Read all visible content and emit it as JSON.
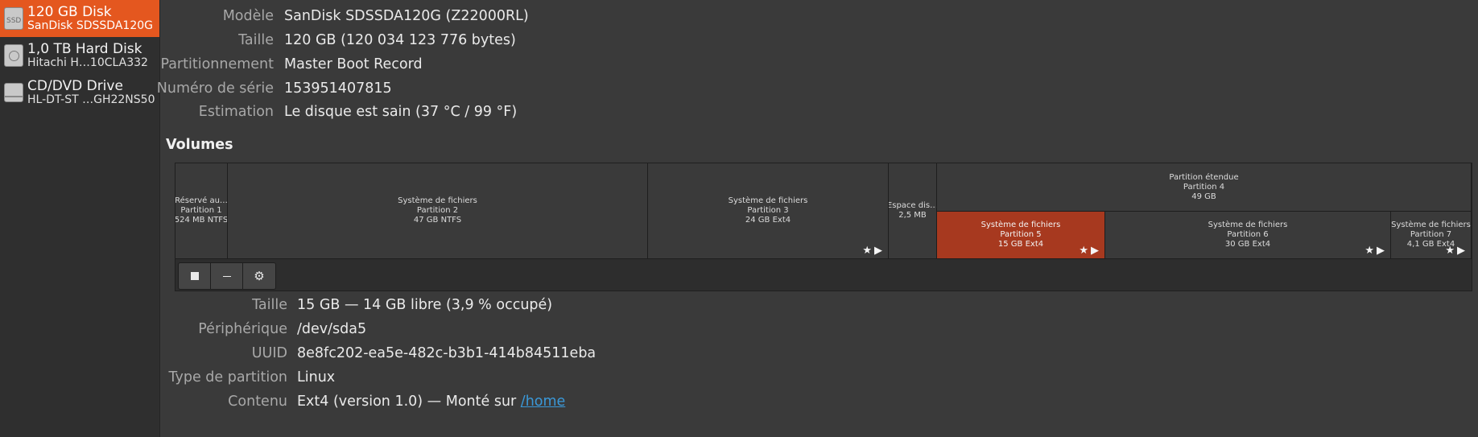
{
  "sidebar": {
    "disks": [
      {
        "name": "120 GB Disk",
        "sub": "SanDisk SDSSDA120G",
        "icon": "ssd-icon",
        "icon_text": "SSD",
        "selected": true
      },
      {
        "name": "1,0 TB Hard Disk",
        "sub": "Hitachi H…10CLA332",
        "icon": "hard-disk-icon",
        "selected": false
      },
      {
        "name": "CD/DVD Drive",
        "sub": "HL-DT-ST …GH22NS50",
        "icon": "optical-drive-icon",
        "selected": false
      }
    ]
  },
  "disk_info": {
    "model_label": "Modèle",
    "model": "SanDisk SDSSDA120G (Z22000RL)",
    "size_label": "Taille",
    "size": "120 GB (120 034 123 776 bytes)",
    "partitioning_label": "Partitionnement",
    "partitioning": "Master Boot Record",
    "serial_label": "Numéro de série",
    "serial": "153951407815",
    "assessment_label": "Estimation",
    "assessment": "Le disque est sain (37 °C / 99 °F)"
  },
  "volumes": {
    "title": "Volumes",
    "segments": [
      {
        "lines": [
          "Réservé au…",
          "Partition 1",
          "524 MB NTFS"
        ]
      },
      {
        "lines": [
          "Système de fichiers",
          "Partition 2",
          "47 GB NTFS"
        ]
      },
      {
        "lines": [
          "Système de fichiers",
          "Partition 3",
          "24 GB Ext4"
        ],
        "actions": "★▶"
      },
      {
        "lines": [
          "Espace dis…",
          "2,5 MB"
        ]
      },
      {
        "lines": [
          "Partition étendue",
          "Partition 4",
          "49 GB"
        ]
      },
      {
        "lines": [
          "Système de fichiers",
          "Partition 5",
          "15 GB Ext4"
        ],
        "actions": "★▶",
        "selected": true
      },
      {
        "lines": [
          "Système de fichiers",
          "Partition 6",
          "30 GB Ext4"
        ],
        "actions": "★▶"
      },
      {
        "lines": [
          "Système de fichiers",
          "Partition 7",
          "4,1 GB Ext4"
        ],
        "actions": "★▶"
      }
    ],
    "toolbar": [
      "stop-icon",
      "minus-icon",
      "gears-icon"
    ]
  },
  "volume_info": {
    "size_label": "Taille",
    "size": "15 GB — 14 GB libre (3,9 % occupé)",
    "device_label": "Périphérique",
    "device": "/dev/sda5",
    "uuid_label": "UUID",
    "uuid": "8e8fc202-ea5e-482c-b3b1-414b84511eba",
    "ptype_label": "Type de partition",
    "ptype": "Linux",
    "contents_label": "Contenu",
    "contents_prefix": "Ext4 (version 1.0) — Monté sur ",
    "mount_link": "/home"
  },
  "colors": {
    "accent": "#e4571f",
    "selected_partition": "#a7391f",
    "link": "#3a98d8"
  }
}
